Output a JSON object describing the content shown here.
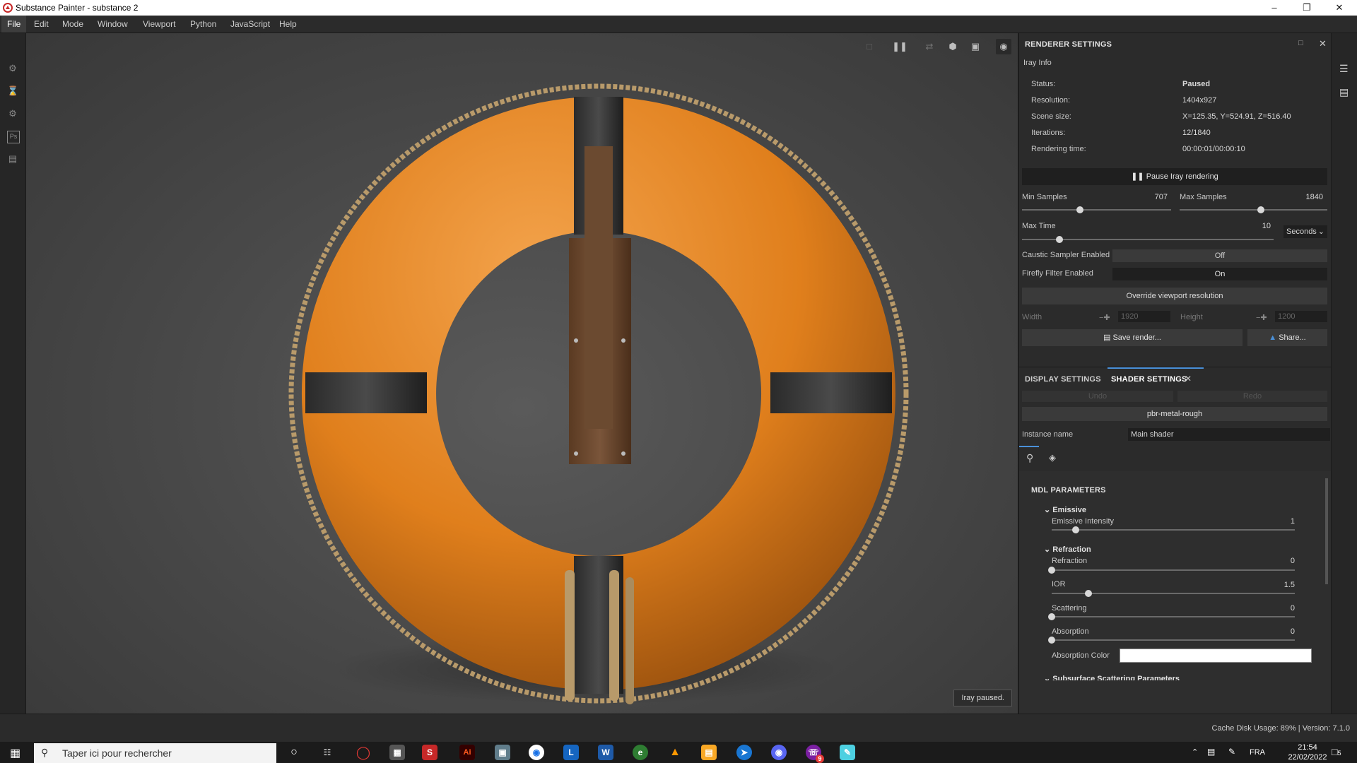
{
  "window": {
    "title": "Substance Painter - substance 2"
  },
  "menu": [
    "File",
    "Edit",
    "Mode",
    "Window",
    "Viewport",
    "Python",
    "JavaScript",
    "Help"
  ],
  "viewport": {
    "status_overlay": "Iray paused."
  },
  "renderer": {
    "title": "RENDERER SETTINGS",
    "section": "Iray Info",
    "info": [
      {
        "label": "Status:",
        "value": "Paused"
      },
      {
        "label": "Resolution:",
        "value": "1404x927"
      },
      {
        "label": "Scene size:",
        "value": "X=125.35, Y=524.91, Z=516.40"
      },
      {
        "label": "Iterations:",
        "value": "12/1840"
      },
      {
        "label": "Rendering time:",
        "value": "00:00:01/00:00:10"
      }
    ],
    "pause_button": "Pause Iray rendering",
    "min_samples": {
      "label": "Min Samples",
      "value": "707",
      "fraction": 0.39
    },
    "max_samples": {
      "label": "Max Samples",
      "value": "1840",
      "fraction": 0.55
    },
    "max_time": {
      "label": "Max Time",
      "value": "10",
      "fraction": 0.15,
      "unit": "Seconds"
    },
    "caustic": {
      "label": "Caustic Sampler Enabled",
      "value": "Off"
    },
    "firefly": {
      "label": "Firefly Filter Enabled",
      "value": "On"
    },
    "override_button": "Override viewport resolution",
    "width": {
      "label": "Width",
      "value": "1920"
    },
    "height": {
      "label": "Height",
      "value": "1200"
    },
    "save_button": "Save render...",
    "share_button": "Share..."
  },
  "tabs": {
    "display": "DISPLAY SETTINGS",
    "shader": "SHADER SETTINGS"
  },
  "shader": {
    "undo": "Undo",
    "redo": "Redo",
    "shader_name": "pbr-metal-rough",
    "instance_label": "Instance name",
    "instance_value": "Main shader",
    "mdl_title": "MDL PARAMETERS",
    "groups": [
      {
        "name": "Emissive",
        "params": [
          {
            "label": "Emissive Intensity",
            "value": "1",
            "fraction": 0.1
          }
        ]
      },
      {
        "name": "Refraction",
        "params": [
          {
            "label": "Refraction",
            "value": "0",
            "fraction": 0.0
          },
          {
            "label": "IOR",
            "value": "1.5",
            "fraction": 0.15
          },
          {
            "label": "Scattering",
            "value": "0",
            "fraction": 0.0
          },
          {
            "label": "Absorption",
            "value": "0",
            "fraction": 0.0
          }
        ]
      }
    ],
    "absorption_color_label": "Absorption Color",
    "absorption_color": "#ffffff",
    "next_group": "Subsurface Scattering Parameters"
  },
  "statusbar": {
    "text": "Cache Disk Usage:  89% | Version: 7.1.0"
  },
  "taskbar": {
    "search_placeholder": "Taper ici pour rechercher",
    "lang": "FRA",
    "time": "21:54",
    "date": "22/02/2022",
    "notif_count": "5",
    "discord_badge": "9"
  },
  "colors": {
    "accent": "#4a90d9",
    "ring": "#e07f1c",
    "panel": "#2b2b2b"
  }
}
